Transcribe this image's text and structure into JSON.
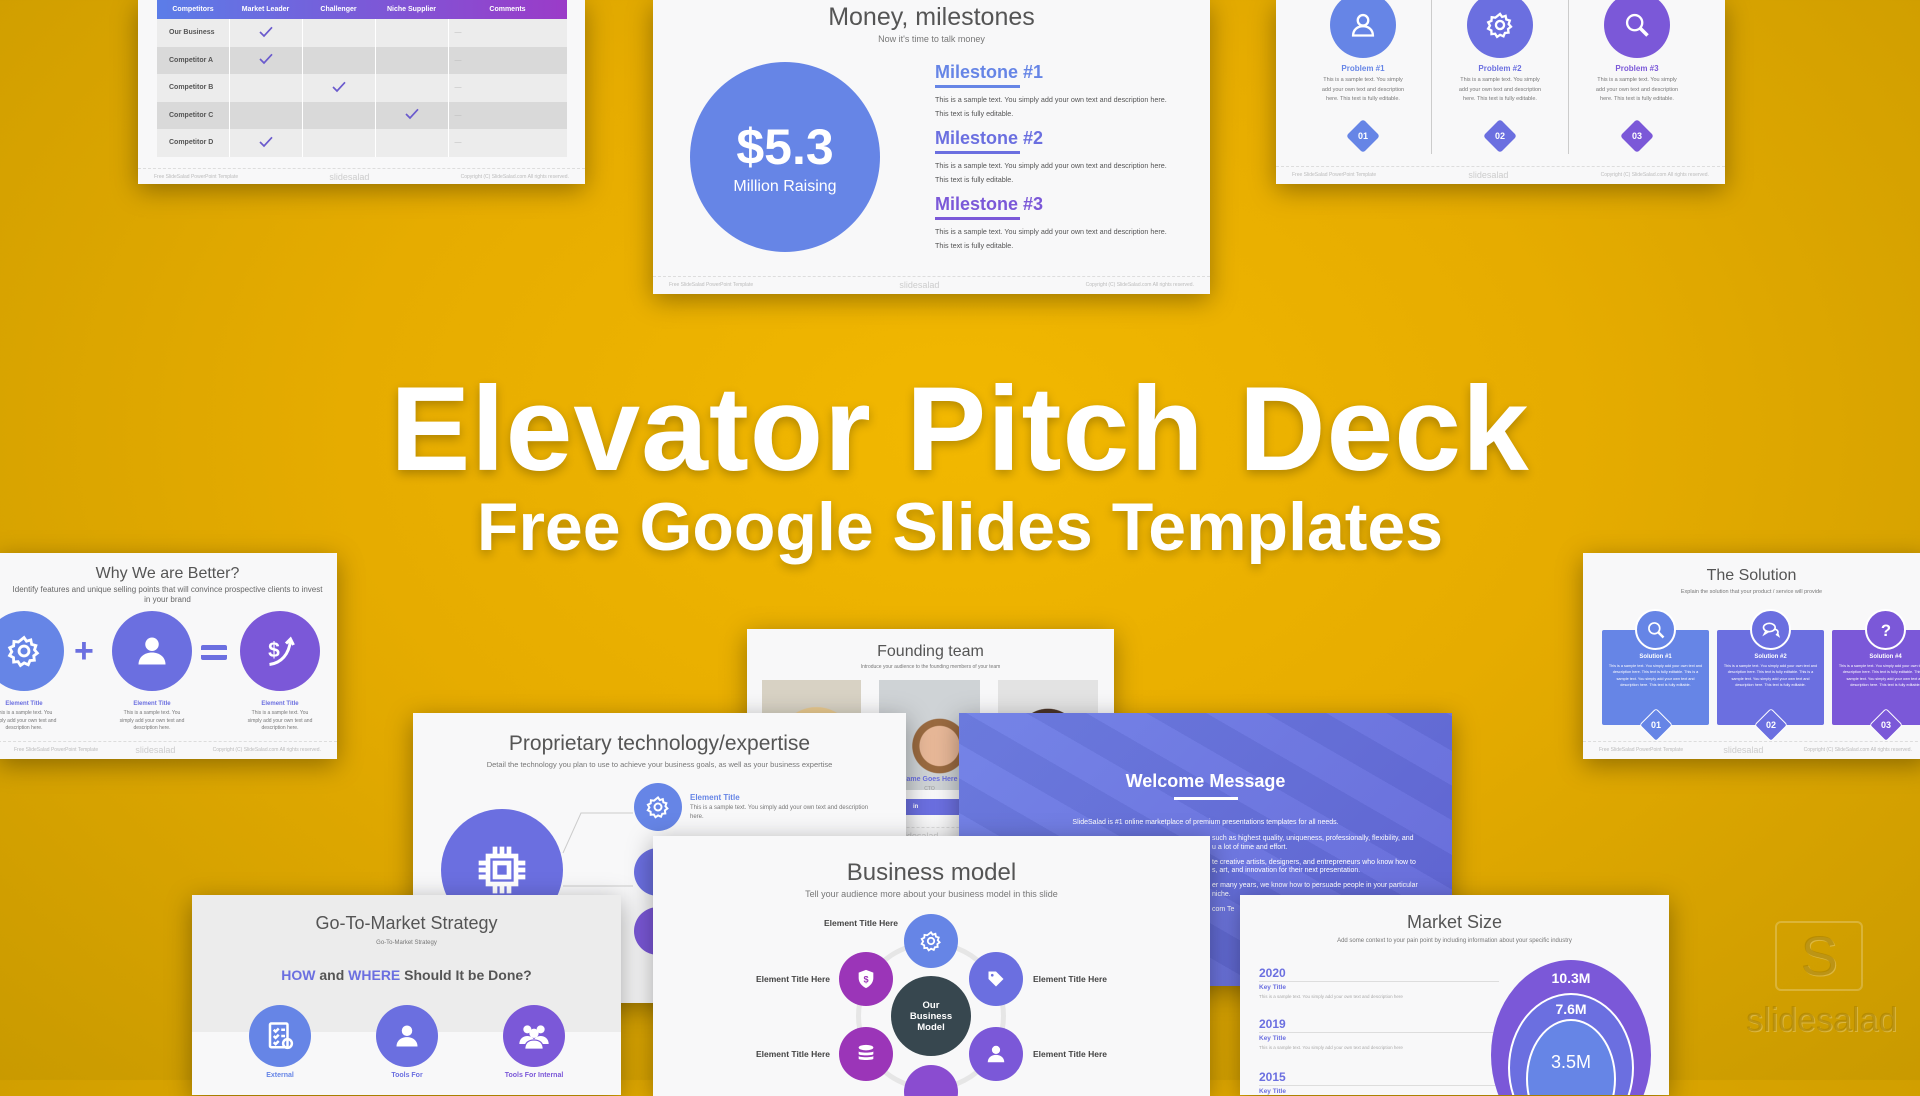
{
  "headline": {
    "title": "Elevator Pitch Deck",
    "subtitle": "Free Google Slides Templates"
  },
  "colors": {
    "background": "#e6ac00",
    "blue": "#6685e6",
    "indigo": "#6b6fe0",
    "purple": "#7b58d8",
    "magenta": "#9b35b8",
    "dark": "#37474f"
  },
  "footer": {
    "left": "Free SlideSalad PowerPoint Template",
    "logo": "slidesalad",
    "right": "Copyright (C) SlideSalad.com All rights reserved."
  },
  "competitors": {
    "headers": [
      "Competitors",
      "Market Leader",
      "Challenger",
      "Niche Supplier",
      "Comments"
    ],
    "rows": [
      {
        "name": "Our Business",
        "check": 1,
        "comment": "—"
      },
      {
        "name": "Competitor A",
        "check": 1,
        "comment": "—"
      },
      {
        "name": "Competitor B",
        "check": 2,
        "comment": "—"
      },
      {
        "name": "Competitor C",
        "check": 3,
        "comment": "—"
      },
      {
        "name": "Competitor D",
        "check": 1,
        "comment": "—"
      }
    ]
  },
  "money": {
    "title": "Money, milestones",
    "subtitle": "Now it's time to talk money",
    "amount": "$5.3",
    "amount_label": "Million Raising",
    "milestones": [
      {
        "title": "Milestone #1",
        "text": "This is a sample text. You simply add your own text and description here. This text is fully editable."
      },
      {
        "title": "Milestone #2",
        "text": "This is a sample text. You simply add your own text and description here. This text is fully editable."
      },
      {
        "title": "Milestone #3",
        "text": "This is a sample text. You simply add your own text and description here. This text is fully editable."
      }
    ]
  },
  "problems": [
    {
      "title": "Problem #1",
      "text": "This is a sample text. You simply add your own text and description here. This text is fully editable.",
      "num": "01",
      "icon": "user-icon"
    },
    {
      "title": "Problem #2",
      "text": "This is a sample text. You simply add your own text and description here. This text is fully editable.",
      "num": "02",
      "icon": "gear-icon"
    },
    {
      "title": "Problem #3",
      "text": "This is a sample text. You simply add your own text and description here. This text is fully editable.",
      "num": "03",
      "icon": "search-icon"
    }
  ],
  "why": {
    "title": "Why We are Better?",
    "subtitle": "Identify features and unique selling points that will convince prospective clients to invest in your brand",
    "items": [
      {
        "title": "Element Title",
        "text": "This is a sample text. You simply add your own text and description here."
      },
      {
        "title": "Element Title",
        "text": "This is a sample text. You simply add your own text and description here."
      },
      {
        "title": "Element Title",
        "text": "This is a sample text. You simply add your own text and description here."
      }
    ]
  },
  "solution": {
    "title": "The Solution",
    "subtitle": "Explain the solution that your product / service will provide",
    "items": [
      {
        "title": "Solution #1",
        "text": "This is a sample text. You simply add your own text and description here. This text is fully editable. This is a sample text. You simply add your own text and description here. This text is fully editable.",
        "num": "01"
      },
      {
        "title": "Solution #2",
        "text": "This is a sample text. You simply add your own text and description here. This text is fully editable. This is a sample text. You simply add your own text and description here. This text is fully editable.",
        "num": "02"
      },
      {
        "title": "Solution #4",
        "text": "This is a sample text. You simply add your own text and description here. This text is fully editable. This is a sample text. You simply add your own text and description here. This text is fully editable.",
        "num": "03"
      }
    ]
  },
  "founding": {
    "title": "Founding team",
    "subtitle": "Introduce your audience to the founding members of your team",
    "member_name": "Name Goes Here",
    "member_role": "CTO",
    "social": [
      "f",
      "t",
      "in"
    ]
  },
  "tech": {
    "title": "Proprietary technology/expertise",
    "subtitle": "Detail the technology you plan to use to achieve your business goals, as well as your business expertise",
    "item_title": "Element Title",
    "item_text": "This is a sample text. You simply add your own text and description here."
  },
  "welcome": {
    "title": "Welcome Message",
    "lines": [
      "SlideSalad is #1 online marketplace of premium presentations templates for all needs.",
      "such as highest quality, uniqueness, professionally, flexibility, and",
      "u a lot of time and effort.",
      "te creative artists, designers, and entrepreneurs who know how to",
      "s, art, and innovation for their next presentation.",
      "er many years, we know how to persuade people in your particular",
      "niche.",
      "com Te"
    ]
  },
  "business": {
    "title": "Business model",
    "subtitle": "Tell your audience more about your business model in this slide",
    "center": "Our Business Model",
    "label": "Element Title Here"
  },
  "gtm": {
    "title": "Go-To-Market Strategy",
    "subtitle": "Go-To-Market Strategy",
    "q_how": "HOW",
    "q_and": " and ",
    "q_where": "WHERE",
    "q_rest": " Should It be Done?",
    "items": [
      "External",
      "Tools For",
      "Tools For Internal"
    ]
  },
  "market": {
    "title": "Market Size",
    "subtitle": "Add some context to your pain point by including information about your specific industry",
    "rows": [
      {
        "year": "2020",
        "key": "Key Title",
        "text": "This is a sample text. You simply add your own text and description here"
      },
      {
        "year": "2019",
        "key": "Key Title",
        "text": "This is a sample text. You simply add your own text and description here"
      },
      {
        "year": "2015",
        "key": "Key Title",
        "text": ""
      }
    ],
    "rings": [
      "10.3M",
      "7.6M",
      "3.5M"
    ]
  },
  "brand": {
    "logo_letter": "S",
    "logo_text": "slidesalad"
  }
}
